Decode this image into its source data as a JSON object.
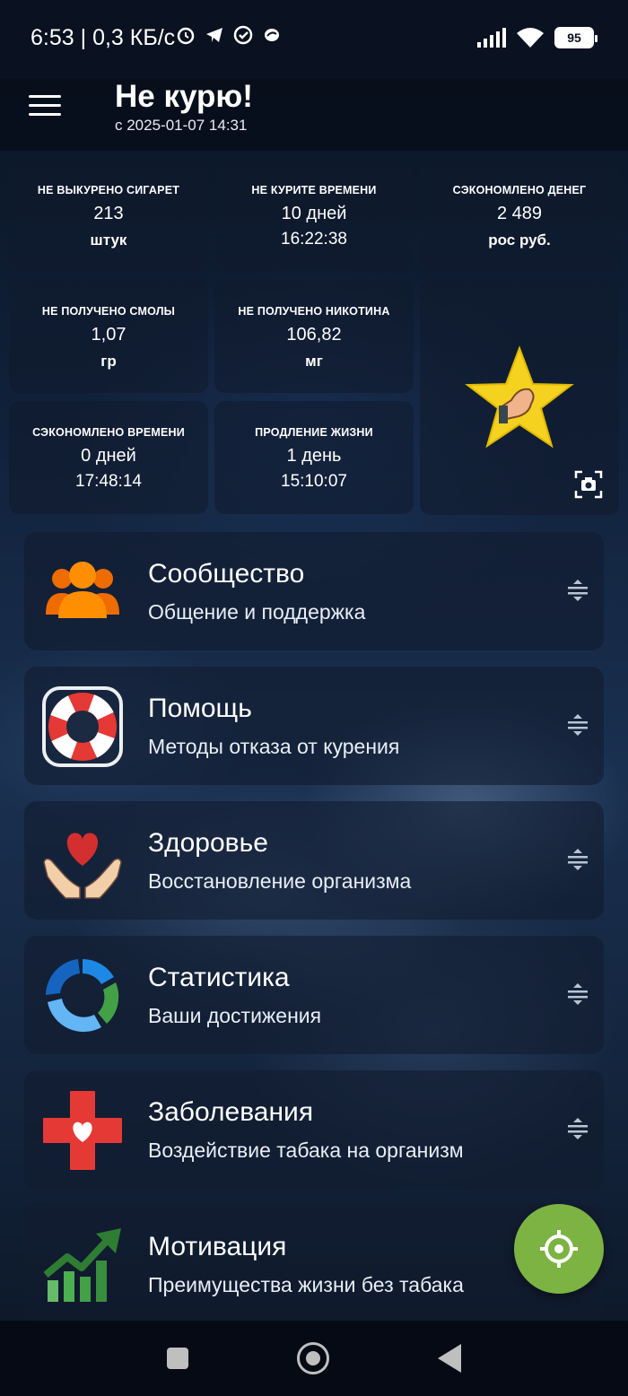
{
  "status_bar": {
    "time": "6:53",
    "speed": "| 0,3 КБ/с",
    "battery": "95"
  },
  "app_bar": {
    "title": "Не курю!",
    "subtitle": "с 2025-01-07 14:31"
  },
  "stats": [
    {
      "label": "НЕ ВЫКУРЕНО СИГАРЕТ",
      "value": "213",
      "unit": "штук"
    },
    {
      "label": "НЕ КУРИТЕ ВРЕМЕНИ",
      "value": "10 дней",
      "unit": "16:22:38"
    },
    {
      "label": "СЭКОНОМЛЕНО ДЕНЕГ",
      "value": "2 489",
      "unit": "рос руб."
    },
    {
      "label": "НЕ ПОЛУЧЕНО СМОЛЫ",
      "value": "1,07",
      "unit": "гр"
    },
    {
      "label": "НЕ ПОЛУЧЕНО НИКОТИНА",
      "value": "106,82",
      "unit": "мг"
    },
    {
      "label": "СЭКОНОМЛЕНО ВРЕМЕНИ",
      "value": "0 дней",
      "unit": "17:48:14"
    },
    {
      "label": "ПРОДЛЕНИЕ ЖИЗНИ",
      "value": "1 день",
      "unit": "15:10:07"
    }
  ],
  "menu": [
    {
      "title": "Сообщество",
      "subtitle": "Общение и поддержка",
      "icon": "community-icon"
    },
    {
      "title": "Помощь",
      "subtitle": "Методы отказа от курения",
      "icon": "lifebuoy-icon"
    },
    {
      "title": "Здоровье",
      "subtitle": "Восстановление организма",
      "icon": "heart-hands-icon"
    },
    {
      "title": "Статистика",
      "subtitle": "Ваши достижения",
      "icon": "statistics-ring-icon"
    },
    {
      "title": "Заболевания",
      "subtitle": "Воздействие табака на организм",
      "icon": "medical-cross-icon"
    },
    {
      "title": "Мотивация",
      "subtitle": "Преимущества жизни без табака",
      "icon": "growth-chart-icon"
    }
  ],
  "colors": {
    "fab": "#7cb342",
    "star": "#f4d21f",
    "community": "#f57c00",
    "lifebuoy": "#e53935",
    "heart": "#d32f2f",
    "cross": "#e53935",
    "growth": "#43a047"
  }
}
